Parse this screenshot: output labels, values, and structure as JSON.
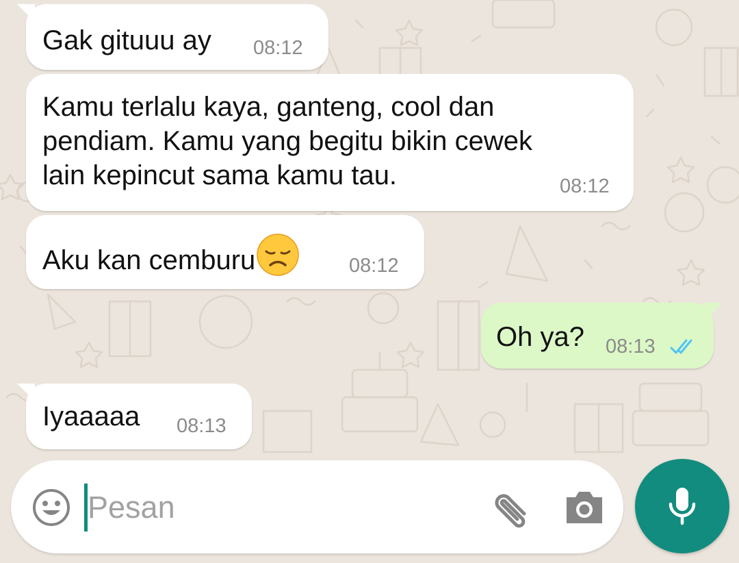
{
  "chat": {
    "messages": [
      {
        "direction": "incoming",
        "text_lines": [
          "Gak gituuu ay"
        ],
        "time": "08:12"
      },
      {
        "direction": "incoming",
        "text_lines": [
          "Kamu terlalu kaya, ganteng, cool dan",
          "pendiam. Kamu yang begitu bikin cewek",
          "lain kepincut sama kamu tau."
        ],
        "time": "08:12"
      },
      {
        "direction": "incoming",
        "text_lines": [
          "Aku kan cemburu"
        ],
        "emoji": "disappointed-face",
        "time": "08:12"
      },
      {
        "direction": "outgoing",
        "text_lines": [
          "Oh ya?"
        ],
        "time": "08:13",
        "status": "read"
      },
      {
        "direction": "incoming",
        "text_lines": [
          "Iyaaaaa"
        ],
        "time": "08:13"
      }
    ]
  },
  "composer": {
    "placeholder": "Pesan",
    "value": "",
    "icons": {
      "emoji": "smiley-icon",
      "attach": "paperclip-icon",
      "camera": "camera-icon",
      "send": "microphone-icon"
    }
  },
  "colors": {
    "wallpaper": "#ECE5DD",
    "incoming_bubble": "#FFFFFF",
    "outgoing_bubble": "#DCF8C6",
    "accent": "#128C7E",
    "read_ticks": "#4FC3F7",
    "timestamp": "#8B8B8B"
  }
}
